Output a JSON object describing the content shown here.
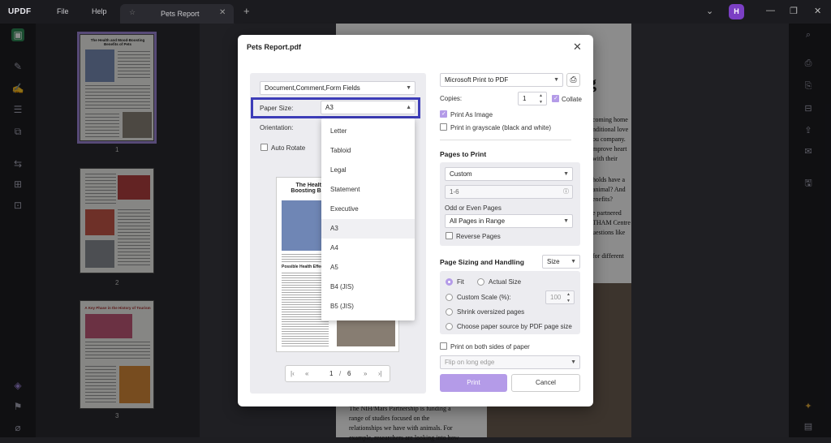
{
  "app": {
    "logo": "UPDF",
    "menu": [
      "File",
      "Help"
    ],
    "tab_title": "Pets Report",
    "avatar": "H"
  },
  "thumbs": {
    "page1_title": "The Health and Mood-Boosting Benefits of Pets",
    "page1_num": "1",
    "page2_num": "2",
    "page3_title": "A Key Phase in the History of Tourism",
    "page3_num": "3"
  },
  "doc": {
    "heading_fragment": "g",
    "right_lines": [
      "coming home",
      "nditional love",
      "ou company.",
      "mprove heart",
      "with their",
      "holds have a",
      "animal? And",
      "enefits?",
      "e partnered",
      "THAM Centre",
      "uestions like",
      "for different"
    ],
    "bottom_lines": [
      "The NIH/Mars Partnership is funding a",
      "range of studies focused on the",
      "relationships we have with animals. For",
      "example, researchers are looking into how"
    ]
  },
  "dialog": {
    "title": "Pets Report.pdf",
    "print_content": "Document,Comment,Form Fields",
    "paper_size_label": "Paper Size:",
    "paper_size_value": "A3",
    "orientation_label": "Orientation:",
    "auto_rotate": "Auto Rotate",
    "paper_options": [
      "Letter",
      "Tabloid",
      "Legal",
      "Statement",
      "Executive",
      "A3",
      "A4",
      "A5",
      "B4 (JIS)",
      "B5 (JIS)"
    ],
    "preview_title": "The Health and Mood-Boosting Benefits of Pets",
    "preview_section": "Possible Health Effects",
    "pager_current": "1",
    "pager_sep": "/",
    "pager_total": "6",
    "printer": "Microsoft Print to PDF",
    "copies_label": "Copies:",
    "copies_value": "1",
    "collate": "Collate",
    "print_as_image": "Print As Image",
    "grayscale": "Print in grayscale (black and white)",
    "pages_head": "Pages to Print",
    "pages_mode": "Custom",
    "pages_range": "1-6",
    "odd_even_label": "Odd or Even Pages",
    "odd_even_value": "All Pages in Range",
    "reverse": "Reverse Pages",
    "sizing_head": "Page Sizing and Handling",
    "sizing_value": "Size",
    "fit": "Fit",
    "actual_size": "Actual Size",
    "custom_scale": "Custom Scale (%):",
    "custom_scale_value": "100",
    "shrink": "Shrink oversized pages",
    "choose_source": "Choose paper source by PDF page size",
    "both_sides": "Print on both sides of paper",
    "flip": "Flip on long edge",
    "print_btn": "Print",
    "cancel_btn": "Cancel"
  },
  "colors": {
    "accent": "#b49be8",
    "highlight": "#3d3db8",
    "avatar": "#7b3fc4"
  }
}
